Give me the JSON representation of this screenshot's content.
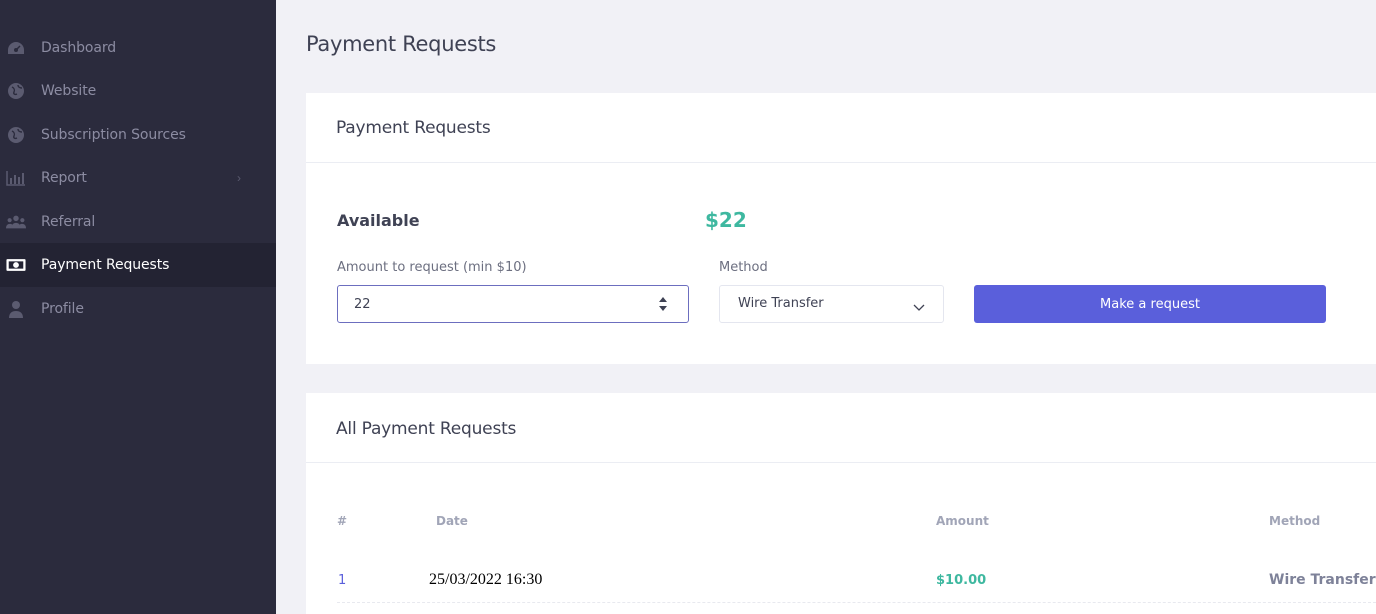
{
  "sidebar": {
    "items": [
      {
        "label": "Dashboard",
        "icon": "dashboard-icon"
      },
      {
        "label": "Website",
        "icon": "globe-icon"
      },
      {
        "label": "Subscription Sources",
        "icon": "globe-icon"
      },
      {
        "label": "Report",
        "icon": "bar-chart-icon"
      },
      {
        "label": "Referral",
        "icon": "users-icon"
      },
      {
        "label": "Payment Requests",
        "icon": "money-icon",
        "active": true
      },
      {
        "label": "Profile",
        "icon": "user-icon"
      }
    ],
    "chevron": "›"
  },
  "page": {
    "title": "Payment Requests"
  },
  "request_card": {
    "title": "Payment Requests",
    "available_label": "Available",
    "available_value": "$22",
    "amount_label": "Amount to request (min $10)",
    "amount_value": "22",
    "method_label": "Method",
    "method_value": "Wire Transfer",
    "submit_label": "Make a request"
  },
  "history_card": {
    "title": "All Payment Requests",
    "columns": [
      "#",
      "Date",
      "Amount",
      "Method"
    ],
    "rows": [
      {
        "num": "1",
        "date": "25/03/2022 16:30",
        "amount": "$10.00",
        "method": "Wire Transfer"
      }
    ]
  },
  "colors": {
    "sidebar_bg": "#2b2b3d",
    "accent": "#5a5fdb",
    "success": "#3eb8a0"
  }
}
